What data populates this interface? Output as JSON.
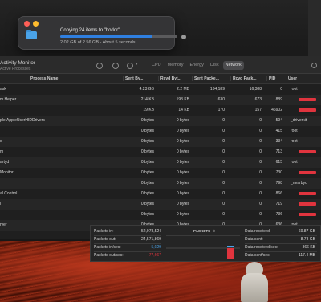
{
  "copy_dialog": {
    "title": "Copying 24 items to \"hodor\"",
    "status": "2.02 GB of 2.56 GB - About 5 seconds",
    "progress": 0.79
  },
  "activity_monitor": {
    "title": "Activity Monitor",
    "subtitle": "Active Processes",
    "tabs": [
      "CPU",
      "Memory",
      "Energy",
      "Disk",
      "Network"
    ],
    "active_tab": "Network",
    "columns": [
      "Process Name",
      "Sent By...",
      "Rcvd Byt...",
      "Sent Packe...",
      "Rcvd Pack...",
      "PID",
      "User"
    ],
    "rows": [
      {
        "name": "ask",
        "sent_bytes": "4.23 GB",
        "rcvd_bytes": "2.2 MB",
        "sent_packets": "134,189",
        "rcvd_packets": "16,388",
        "pid": "0",
        "user": "root",
        "redacted": false
      },
      {
        "name": "m Helper",
        "sent_bytes": "214 KB",
        "rcvd_bytes": "193 KB",
        "sent_packets": "630",
        "rcvd_packets": "673",
        "pid": "889",
        "user": "",
        "redacted": true
      },
      {
        "name": "",
        "sent_bytes": "19 KB",
        "rcvd_bytes": "14 KB",
        "sent_packets": "170",
        "rcvd_packets": "157",
        "pid": "46902",
        "user": "",
        "redacted": true
      },
      {
        "name": "ple.AppleUserHIDDrivers",
        "sent_bytes": "0 bytes",
        "rcvd_bytes": "0 bytes",
        "sent_packets": "0",
        "rcvd_packets": "0",
        "pid": "594",
        "user": "_driverkit",
        "redacted": false
      },
      {
        "name": "",
        "sent_bytes": "0 bytes",
        "rcvd_bytes": "0 bytes",
        "sent_packets": "0",
        "rcvd_packets": "0",
        "pid": "415",
        "user": "root",
        "redacted": false
      },
      {
        "name": "d",
        "sent_bytes": "0 bytes",
        "rcvd_bytes": "0 bytes",
        "sent_packets": "0",
        "rcvd_packets": "0",
        "pid": "334",
        "user": "root",
        "redacted": false
      },
      {
        "name": "m",
        "sent_bytes": "0 bytes",
        "rcvd_bytes": "0 bytes",
        "sent_packets": "0",
        "rcvd_packets": "0",
        "pid": "713",
        "user": "",
        "redacted": true
      },
      {
        "name": "artyd",
        "sent_bytes": "0 bytes",
        "rcvd_bytes": "0 bytes",
        "sent_packets": "0",
        "rcvd_packets": "0",
        "pid": "615",
        "user": "root",
        "redacted": false
      },
      {
        "name": "Monitor",
        "sent_bytes": "0 bytes",
        "rcvd_bytes": "0 bytes",
        "sent_packets": "0",
        "rcvd_packets": "0",
        "pid": "730",
        "user": "",
        "redacted": true
      },
      {
        "name": "",
        "sent_bytes": "0 bytes",
        "rcvd_bytes": "0 bytes",
        "sent_packets": "0",
        "rcvd_packets": "0",
        "pid": "798",
        "user": "_nearbyd",
        "redacted": false
      },
      {
        "name": "al Control",
        "sent_bytes": "0 bytes",
        "rcvd_bytes": "0 bytes",
        "sent_packets": "0",
        "rcvd_packets": "0",
        "pid": "866",
        "user": "",
        "redacted": true
      },
      {
        "name": "l",
        "sent_bytes": "0 bytes",
        "rcvd_bytes": "0 bytes",
        "sent_packets": "0",
        "rcvd_packets": "0",
        "pid": "719",
        "user": "",
        "redacted": true
      },
      {
        "name": "",
        "sent_bytes": "0 bytes",
        "rcvd_bytes": "0 bytes",
        "sent_packets": "0",
        "rcvd_packets": "0",
        "pid": "736",
        "user": "",
        "redacted": true
      },
      {
        "name": "rver",
        "sent_bytes": "0 bytes",
        "rcvd_bytes": "0 bytes",
        "sent_packets": "0",
        "rcvd_packets": "0",
        "pid": "636",
        "user": "root",
        "redacted": false
      }
    ],
    "footer": {
      "left": [
        {
          "label": "Packets in:",
          "value": "52,978,524"
        },
        {
          "label": "Packets out:",
          "value": "24,571,869"
        },
        {
          "label": "Packets in/sec:",
          "value": "5,029",
          "color": "#4aa3e8"
        },
        {
          "label": "Packets out/sec:",
          "value": "77,667",
          "color": "#e0343e"
        }
      ],
      "graph_title": "PACKETS",
      "right": [
        {
          "label": "Data received:",
          "value": "69.87 GB"
        },
        {
          "label": "Data sent:",
          "value": "8.78 GB"
        },
        {
          "label": "Data received/sec:",
          "value": "366 KB"
        },
        {
          "label": "Data sent/sec:",
          "value": "117.4 MB"
        }
      ]
    }
  }
}
